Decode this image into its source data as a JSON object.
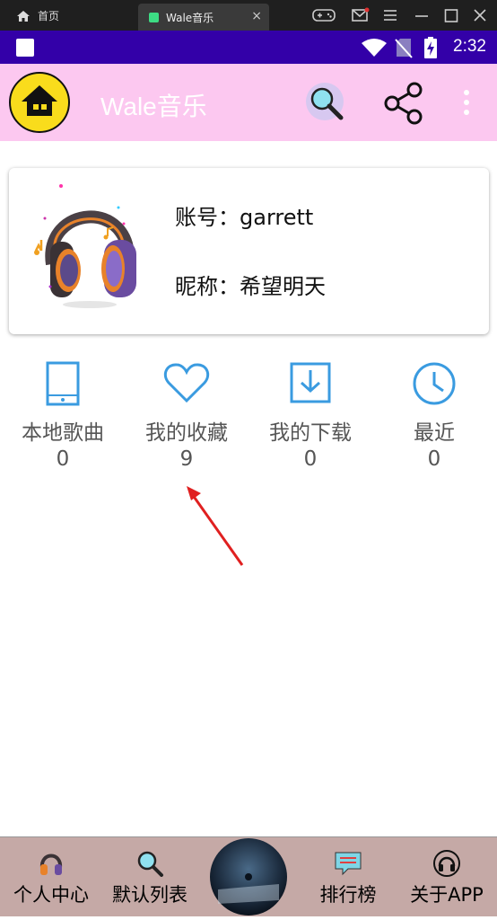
{
  "emulator": {
    "home_label": "首页",
    "tab_title": "Wale音乐",
    "tab_close": "×"
  },
  "status_bar": {
    "time": "2:32"
  },
  "toolbar": {
    "title": "Wale音乐"
  },
  "profile": {
    "account_label": "账号：garrett",
    "nickname_label": "昵称：希望明天"
  },
  "stats": [
    {
      "label": "本地歌曲",
      "count": "0",
      "icon": "tablet-icon"
    },
    {
      "label": "我的收藏",
      "count": "9",
      "icon": "heart-icon"
    },
    {
      "label": "我的下载",
      "count": "0",
      "icon": "download-icon"
    },
    {
      "label": "最近",
      "count": "0",
      "icon": "clock-icon"
    }
  ],
  "bottom_nav": [
    {
      "label": "个人中心",
      "icon": "headphones-icon"
    },
    {
      "label": "默认列表",
      "icon": "search-icon"
    },
    {
      "label": "",
      "icon": "album-disc"
    },
    {
      "label": "排行榜",
      "icon": "chat-icon"
    },
    {
      "label": "关于APP",
      "icon": "headset-icon"
    }
  ],
  "colors": {
    "status_bar": "#3300a8",
    "toolbar": "#fcc8f0",
    "icon_blue": "#3a9be0",
    "bottom_nav": "#c5a9a6",
    "arrow": "#e02020"
  }
}
